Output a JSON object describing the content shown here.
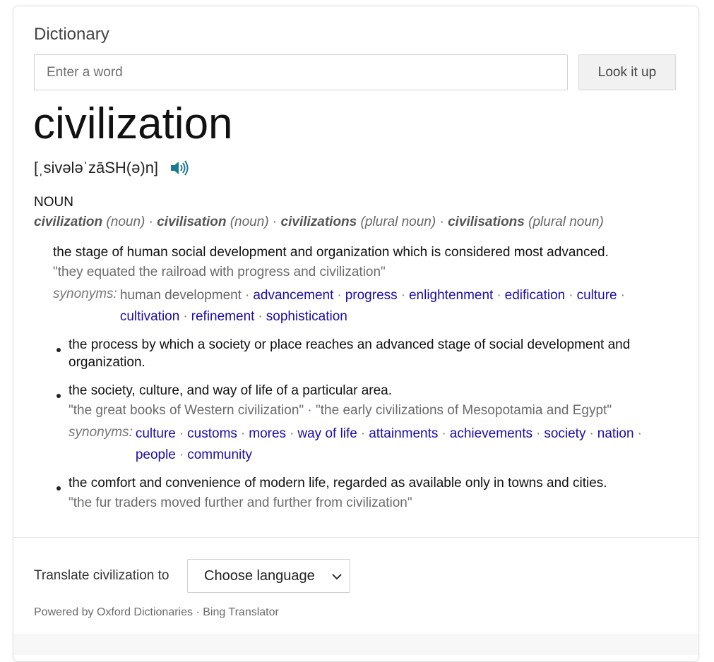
{
  "dictionary": {
    "title": "Dictionary",
    "search": {
      "placeholder": "Enter a word",
      "value": ""
    },
    "lookup_label": "Look it up"
  },
  "entry": {
    "word": "civilization",
    "pronunciation": "[ˌsivələˈzāSH(ə)n]",
    "audio_icon": "speaker-icon",
    "part_of_speech": "NOUN",
    "forms": [
      {
        "word": "civilization",
        "type": "(noun)"
      },
      {
        "word": "civilisation",
        "type": "(noun)"
      },
      {
        "word": "civilizations",
        "type": "(plural noun)"
      },
      {
        "word": "civilisations",
        "type": "(plural noun)"
      }
    ],
    "senses": [
      {
        "definition": "the stage of human social development and organization which is considered most advanced.",
        "examples": [
          "\"they equated the railroad with progress and civilization\""
        ],
        "synonyms_label": "synonyms:",
        "synonyms": [
          {
            "text": "human development",
            "link": false
          },
          {
            "text": "advancement",
            "link": true
          },
          {
            "text": "progress",
            "link": true
          },
          {
            "text": "enlightenment",
            "link": true
          },
          {
            "text": "edification",
            "link": true
          },
          {
            "text": "culture",
            "link": true
          },
          {
            "text": "cultivation",
            "link": true
          },
          {
            "text": "refinement",
            "link": true
          },
          {
            "text": "sophistication",
            "link": true
          }
        ]
      },
      {
        "definition": "the process by which a society or place reaches an advanced stage of social development and organization."
      },
      {
        "definition": "the society, culture, and way of life of a particular area.",
        "examples": [
          "\"the great books of Western civilization\"",
          "\"the early civilizations of Mesopotamia and Egypt\""
        ],
        "synonyms_label": "synonyms:",
        "synonyms": [
          {
            "text": "culture",
            "link": true
          },
          {
            "text": "customs",
            "link": true
          },
          {
            "text": "mores",
            "link": true
          },
          {
            "text": "way of life",
            "link": true
          },
          {
            "text": "attainments",
            "link": true
          },
          {
            "text": "achievements",
            "link": true
          },
          {
            "text": "society",
            "link": true
          },
          {
            "text": "nation",
            "link": true
          },
          {
            "text": "people",
            "link": true
          },
          {
            "text": "community",
            "link": true
          }
        ]
      },
      {
        "definition": "the comfort and convenience of modern life, regarded as available only in towns and cities.",
        "examples": [
          "\"the fur traders moved further and further from civilization\""
        ]
      }
    ]
  },
  "translate": {
    "label": "Translate civilization to",
    "select_value": "Choose language",
    "select_icon": "chevron-down-icon"
  },
  "footer": {
    "powered_prefix": "Powered by",
    "oxford": "Oxford Dictionaries",
    "separator": "·",
    "bing": "Bing Translator"
  },
  "colors": {
    "link": "#1a0dab",
    "example": "#6b6b6b",
    "audio": "#1a7a93"
  }
}
